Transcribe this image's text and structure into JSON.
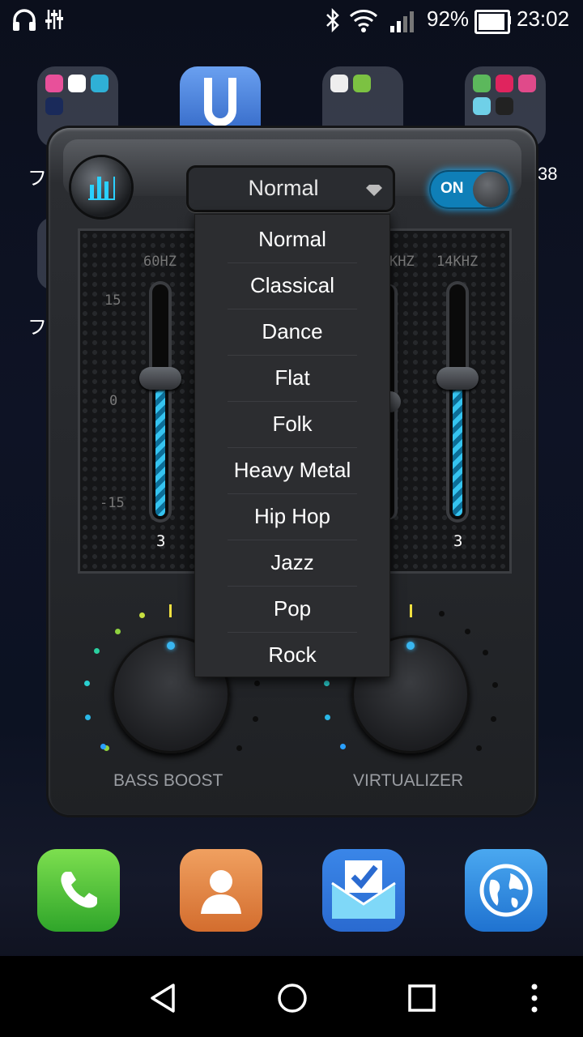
{
  "status_bar": {
    "battery": "92%",
    "time": "23:02",
    "icons": [
      "headphones-icon",
      "equalizer-icon",
      "bluetooth-icon",
      "wifi-icon",
      "signal-icon",
      "battery-icon"
    ]
  },
  "home": {
    "edge_labels": [
      "フ",
      "フ",
      "38"
    ]
  },
  "equalizer": {
    "preset_selected": "Normal",
    "toggle_label": "ON",
    "frequencies": [
      "60HZ",
      "KHZ",
      "14KHZ"
    ],
    "scale": [
      "15",
      "0",
      "-15"
    ],
    "band_values": [
      "3",
      "3"
    ],
    "bass_boost_label": "BASS BOOST",
    "virtualizer_label": "VIRTUALIZER"
  },
  "dropdown": {
    "options": [
      "Normal",
      "Classical",
      "Dance",
      "Flat",
      "Folk",
      "Heavy Metal",
      "Hip Hop",
      "Jazz",
      "Pop",
      "Rock"
    ]
  },
  "dock": {
    "apps": [
      "phone-icon",
      "contacts-icon",
      "inbox-icon",
      "browser-icon"
    ]
  },
  "colors": {
    "accent": "#1ab0ff",
    "toggle_on": "#0f7fb8"
  }
}
